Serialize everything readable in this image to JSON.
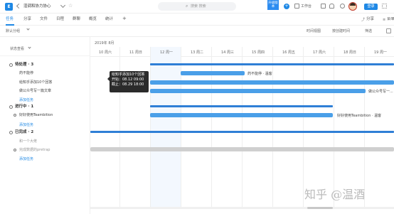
{
  "topbar": {
    "project_initial": "E",
    "project_name": "渲调和协力协心",
    "search_placeholder": "搜索 搜索",
    "upgrade_label": "升级版本",
    "workspace_label": "工作台",
    "login_label": "登录",
    "icons": [
      "star-icon",
      "plus-icon",
      "search-icon",
      "upgrade-icon",
      "add-icon",
      "workspace-icon",
      "calendar-icon",
      "bell-icon",
      "question-icon",
      "grid-icon",
      "avatar-image"
    ]
  },
  "tabs": {
    "items": [
      "任务",
      "分享",
      "文件",
      "日程",
      "群聊",
      "概览",
      "统计"
    ],
    "active": "任务",
    "add": "+",
    "share_label": "分享",
    "menu_label": "菜单"
  },
  "toolbar": {
    "group_label": "默认分组",
    "view_label": "时间视图",
    "sort_label": "按创建时间",
    "filter_label": "筛选"
  },
  "left": {
    "status_label": "状态查看",
    "groups": [
      {
        "name": "待处理 · 3",
        "tasks": [
          "药不能停",
          "给知乎添加10个回答",
          "做公众号写一篇文章"
        ],
        "add": "添加任务"
      },
      {
        "name": "进行中 · 1",
        "tasks": [
          "好好使用Teambition"
        ],
        "add": "添加任务"
      },
      {
        "name": "已完成 · 2",
        "tasks": [
          "和一个大佬",
          "完成数据的pretrap"
        ],
        "add": "添加任务"
      }
    ]
  },
  "gantt": {
    "month_label": "2019年 8月",
    "days": [
      "10 周六",
      "11 周日",
      "12 周一",
      "13 周二",
      "14 周三",
      "15 周四",
      "16 周五",
      "17 周六",
      "18 周日",
      "19 周一"
    ],
    "bar_labels": {
      "task1": "药不能停 · 温客",
      "task3": "做公众号写一...",
      "task4": "好好使用Teambition · 温客"
    },
    "tooltip": {
      "title": "给知乎添加10个回答",
      "start": "开始：08.12 09:00",
      "end": "截止：08.29 18:00"
    }
  },
  "watermark": "知乎 @温酒",
  "colors": {
    "accent": "#1e88e5",
    "bar": "#4a9fe8",
    "completed_bar": "#cfcfcf"
  }
}
